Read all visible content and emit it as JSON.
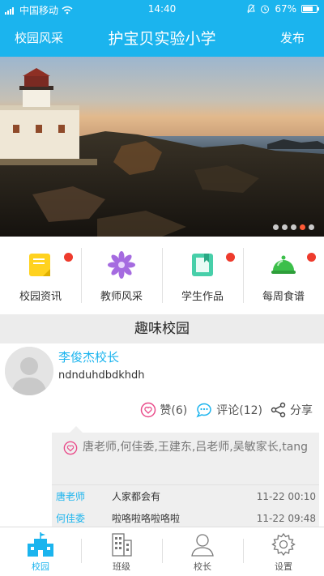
{
  "status_bar": {
    "carrier": "中国移动",
    "time": "14:40",
    "battery": "67%"
  },
  "nav": {
    "left": "校园风采",
    "title": "护宝贝实验小学",
    "right": "发布"
  },
  "banner": {
    "slides": 5,
    "active_slide": 4
  },
  "categories": [
    {
      "label": "校园资讯",
      "icon": "news-icon",
      "badge": true
    },
    {
      "label": "教师风采",
      "icon": "flower-icon",
      "badge": false
    },
    {
      "label": "学生作品",
      "icon": "book-icon",
      "badge": true
    },
    {
      "label": "每周食谱",
      "icon": "food-cover-icon",
      "badge": true
    }
  ],
  "section_title": "趣味校园",
  "post": {
    "author": "李俊杰校长",
    "content": "ndnduhdbdkhdh",
    "like_label": "赞(6)",
    "comment_label": "评论(12)",
    "share_label": "分享",
    "liked_by": "唐老师,何佳委,王建东,吕老师,吴敏家长,tang",
    "comments": [
      {
        "who": "唐老师",
        "text": "人家都会有",
        "time": "11-22 00:10"
      },
      {
        "who": "何佳委",
        "text": "啦咯啦咯啦咯啦",
        "time": "11-22 09:48"
      }
    ]
  },
  "tabs": [
    {
      "label": "校园",
      "icon": "school-icon",
      "active": true
    },
    {
      "label": "班级",
      "icon": "building-icon",
      "active": false
    },
    {
      "label": "校长",
      "icon": "person-icon",
      "active": false
    },
    {
      "label": "设置",
      "icon": "gear-icon",
      "active": false
    }
  ],
  "colors": {
    "primary": "#1bb4ee",
    "badge": "#ee3b2d",
    "like": "#e94b8a",
    "comment": "#1bb4ee"
  }
}
